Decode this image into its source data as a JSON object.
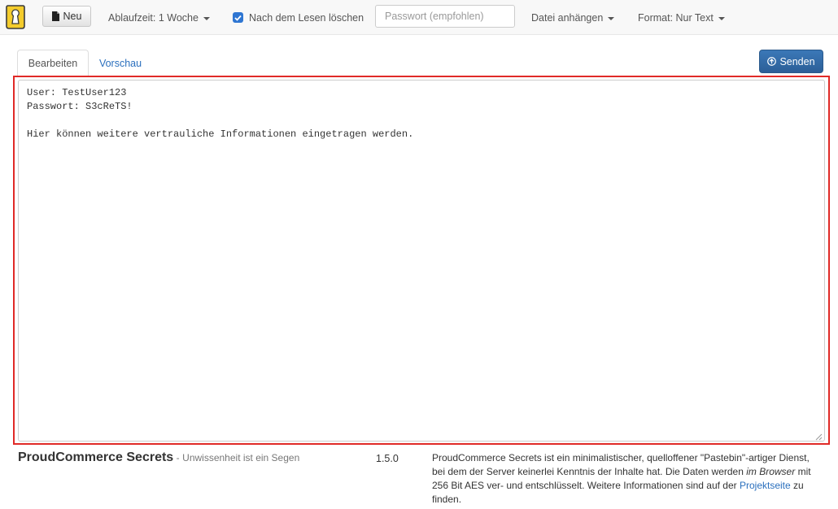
{
  "colors": {
    "accent": "#2f76d2",
    "send_button": "#3370b0",
    "highlight_border": "#e02a27",
    "logo": "#f4cc2c",
    "link": "#2a6fbd"
  },
  "navbar": {
    "logo_icon": "keyhole-logo-icon",
    "new_button": {
      "label": "Neu",
      "icon": "file-icon"
    },
    "expiry_dropdown": {
      "label": "Ablaufzeit: 1 Woche"
    },
    "burn_after_reading": {
      "label": "Nach dem Lesen löschen",
      "checked": true
    },
    "password_input": {
      "placeholder": "Passwort (empfohlen)",
      "value": ""
    },
    "attach_dropdown": {
      "label": "Datei anhängen"
    },
    "format_dropdown": {
      "label": "Format: Nur Text"
    }
  },
  "tabs": [
    {
      "label": "Bearbeiten",
      "active": true
    },
    {
      "label": "Vorschau",
      "active": false
    }
  ],
  "send_button": {
    "label": "Senden",
    "icon": "circle-arrow-up-icon"
  },
  "editor": {
    "content": "User: TestUser123\nPasswort: S3cReTS!\n\nHier können weitere vertrauliche Informationen eingetragen werden."
  },
  "footer": {
    "brand_name": "ProudCommerce Secrets",
    "separator": "-",
    "tagline": "Unwissenheit ist ein Segen",
    "version": "1.5.0",
    "about": {
      "part1": "ProudCommerce Secrets ist ein minimalistischer, quelloffener \"Pastebin\"-artiger Dienst, bei dem der Server keinerlei Kenntnis der Inhalte hat. Die Daten werden ",
      "emphasis": "im Browser",
      "part2": " mit 256 Bit AES ver- und entschlüsselt. Weitere Informationen sind auf der ",
      "link": "Projektseite",
      "part3": " zu finden."
    }
  }
}
